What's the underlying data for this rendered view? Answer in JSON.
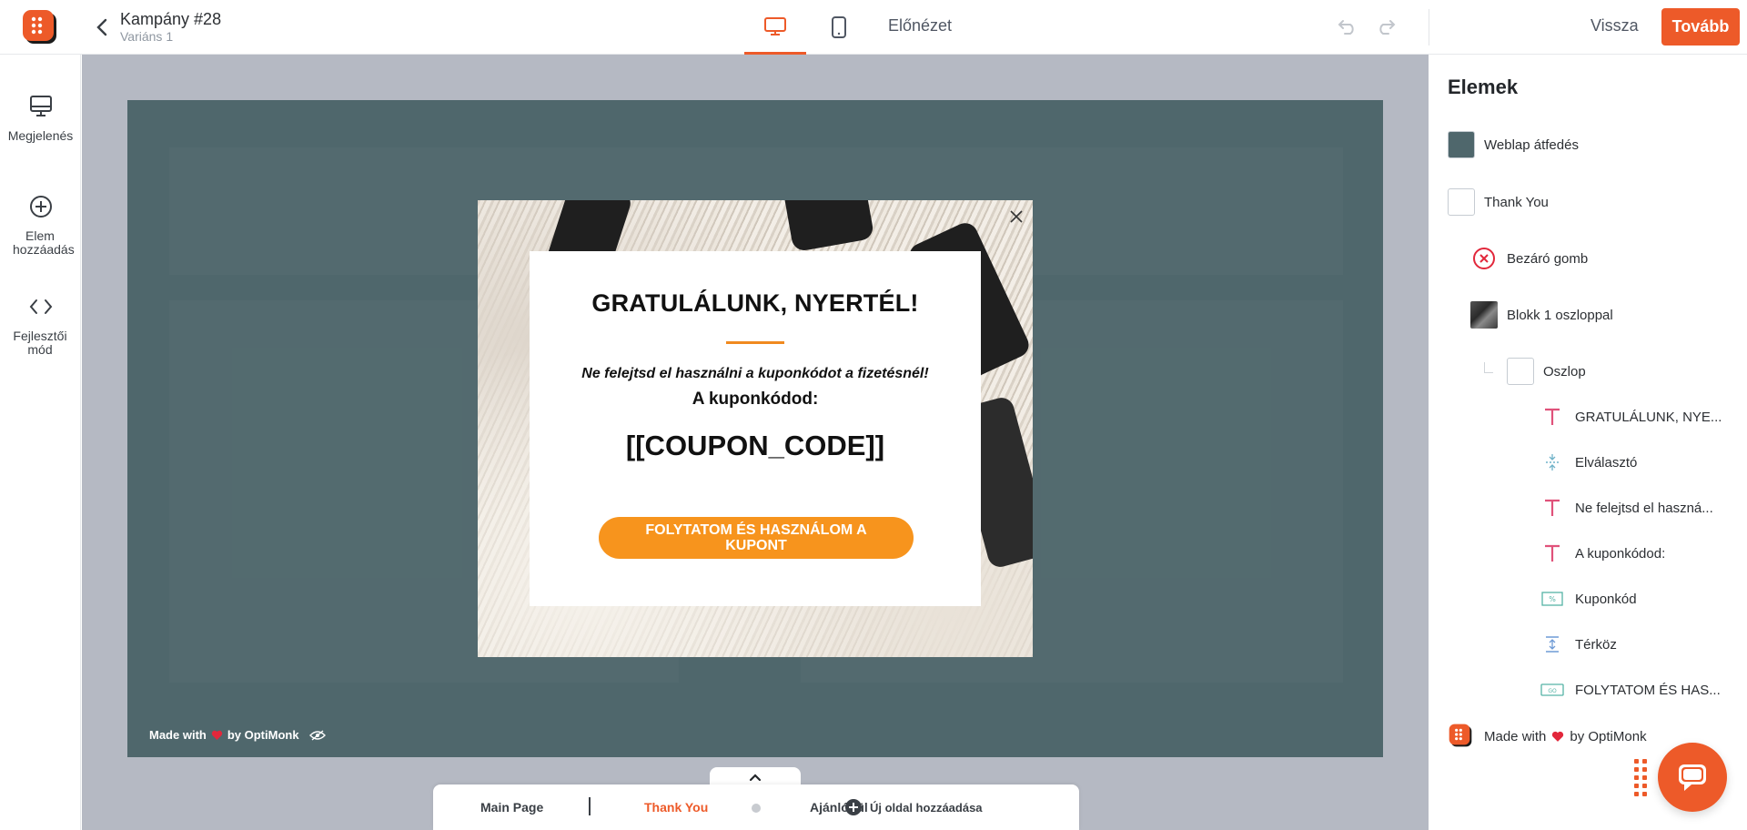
{
  "header": {
    "campaign_name": "Kampány #28",
    "variant": "Variáns 1",
    "preview_label": "Előnézet",
    "back_label": "Vissza",
    "next_label": "Tovább"
  },
  "sidebar": {
    "items": [
      {
        "label": "Megjelenés",
        "icon": "monitor-icon"
      },
      {
        "label": "Elem hozzáadás",
        "icon": "plus-circle-icon"
      },
      {
        "label": "Fejlesztői mód",
        "icon": "code-icon"
      }
    ]
  },
  "canvas": {
    "popup": {
      "title": "GRATULÁLUNK, NYERTÉL!",
      "subtitle": "Ne felejtsd el használni a kuponkódot a fizetésnél!",
      "coupon_label": "A kuponkódod:",
      "coupon_code": "[[COUPON_CODE]]",
      "cta": "FOLYTATOM ÉS HASZNÁLOM A KUPONT"
    },
    "branding": {
      "made_with": "Made with",
      "by": "by OptiMonk"
    },
    "overlay_color": "#4f676c"
  },
  "page_tabs": {
    "main_page": "Main Page",
    "thank_you": "Thank You",
    "teaser": "Ajánló fül",
    "add_page": "Új oldal hozzáadása"
  },
  "layers": {
    "title": "Elemek",
    "items": [
      {
        "label": "Weblap átfedés",
        "icon": "color-swatch"
      },
      {
        "label": "Thank You",
        "icon": "white-swatch"
      },
      {
        "label": "Bezáró gomb",
        "icon": "close-circle-icon"
      },
      {
        "label": "Blokk 1 oszloppal",
        "icon": "image-thumb"
      },
      {
        "label": "Oszlop",
        "icon": "column-icon"
      },
      {
        "label": "GRATULÁLUNK, NYE...",
        "icon": "text-icon"
      },
      {
        "label": "Elválasztó",
        "icon": "divider-icon"
      },
      {
        "label": "Ne felejtsd el haszná...",
        "icon": "text-icon"
      },
      {
        "label": "A kuponkódod:",
        "icon": "text-icon"
      },
      {
        "label": "Kuponkód",
        "icon": "coupon-icon"
      },
      {
        "label": "Térköz",
        "icon": "spacer-icon"
      },
      {
        "label": "FOLYTATOM ÉS HAS...",
        "icon": "button-icon"
      },
      {
        "label": "Made with",
        "icon": "optimonk-logo-icon"
      }
    ],
    "branding_suffix": "by OptiMonk"
  },
  "colors": {
    "accent": "#ed5a29",
    "cta": "#f7941d",
    "layer_text_icon": "#e0527a"
  }
}
